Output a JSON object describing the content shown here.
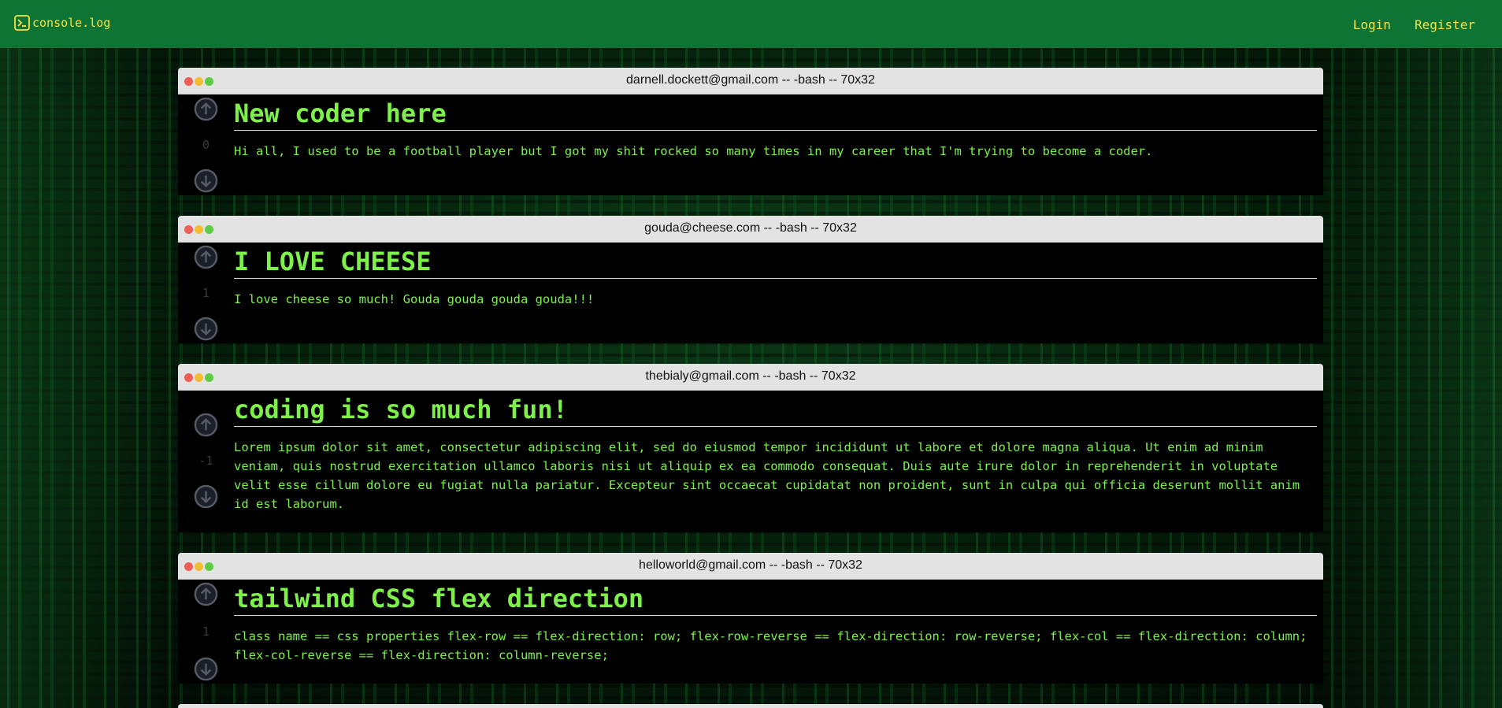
{
  "nav": {
    "logo_text": "console.log",
    "login_label": "Login",
    "register_label": "Register"
  },
  "posts": [
    {
      "author_bar": "darnell.dockett@gmail.com -- -bash -- 70x32",
      "score": "0",
      "title": "New coder here",
      "body": "Hi all, I used to be a football player but I got my shit rocked so many times in my career that I'm trying to become a coder."
    },
    {
      "author_bar": "gouda@cheese.com -- -bash -- 70x32",
      "score": "1",
      "title": "I LOVE CHEESE",
      "body": "I love cheese so much! Gouda gouda gouda gouda!!!"
    },
    {
      "author_bar": "thebialy@gmail.com -- -bash -- 70x32",
      "score": "-1",
      "title": "coding is so much fun!",
      "body": "Lorem ipsum dolor sit amet, consectetur adipiscing elit, sed do eiusmod tempor incididunt ut labore et dolore magna aliqua. Ut enim ad minim veniam, quis nostrud exercitation ullamco laboris nisi ut aliquip ex ea commodo consequat. Duis aute irure dolor in reprehenderit in voluptate velit esse cillum dolore eu fugiat nulla pariatur. Excepteur sint occaecat cupidatat non proident, sunt in culpa qui officia deserunt mollit anim id est laborum."
    },
    {
      "author_bar": "helloworld@gmail.com -- -bash -- 70x32",
      "score": "1",
      "title": "tailwind CSS flex direction",
      "body": "class name == css properties flex-row == flex-direction: row; flex-row-reverse == flex-direction: row-reverse; flex-col == flex-direction: column; flex-col-reverse == flex-direction: column-reverse;"
    }
  ],
  "colors": {
    "navbar": "#0d7434",
    "nav_text": "#f6e24a",
    "post_text": "#7ef04a",
    "titlebar": "#e3e3e3"
  },
  "icons": {
    "logo": "terminal-icon",
    "upvote": "arrow-up-circle-icon",
    "downvote": "arrow-down-circle-icon"
  }
}
